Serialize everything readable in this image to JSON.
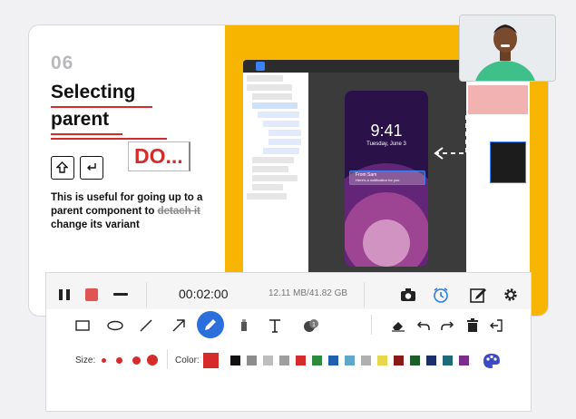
{
  "slide": {
    "number": "06",
    "title_line1": "Selecting",
    "title_line2": "parent",
    "shortcut_label": "DO...",
    "body_prefix": "This is useful for going up to a parent component to ",
    "body_strike": "detach it",
    "body_suffix": " change its variant"
  },
  "figma": {
    "phone_time": "9:41",
    "phone_date": "Tuesday, June 3",
    "notif_title": "From Sam",
    "notif_body": "Here's a notification for you"
  },
  "recorder": {
    "elapsed": "00:02:00",
    "storage": "12.11 MB/41.82 GB"
  },
  "draw": {
    "size_label": "Size:",
    "color_label": "Color:",
    "selected_color": "#d62b2b",
    "colors": [
      "#111111",
      "#8c8c8c",
      "#bdbdbd",
      "#9e9e9e",
      "#d62b2b",
      "#2e8b3c",
      "#1f5fae",
      "#5fa8c9",
      "#b0b0b0",
      "#e6d84a",
      "#8a1a1a",
      "#1b5e2a",
      "#1a2f6b",
      "#1e6b73",
      "#7b2d8b"
    ]
  },
  "icons": [
    "pause-icon",
    "stop-icon",
    "minimize-icon",
    "camera-icon",
    "timer-icon",
    "edit-icon",
    "gear-icon",
    "rectangle-icon",
    "ellipse-icon",
    "line-icon",
    "arrow-icon",
    "pen-icon",
    "highlighter-icon",
    "text-icon",
    "stamp-icon",
    "eraser-icon",
    "undo-icon",
    "redo-icon",
    "trash-icon",
    "exit-icon",
    "palette-icon"
  ]
}
